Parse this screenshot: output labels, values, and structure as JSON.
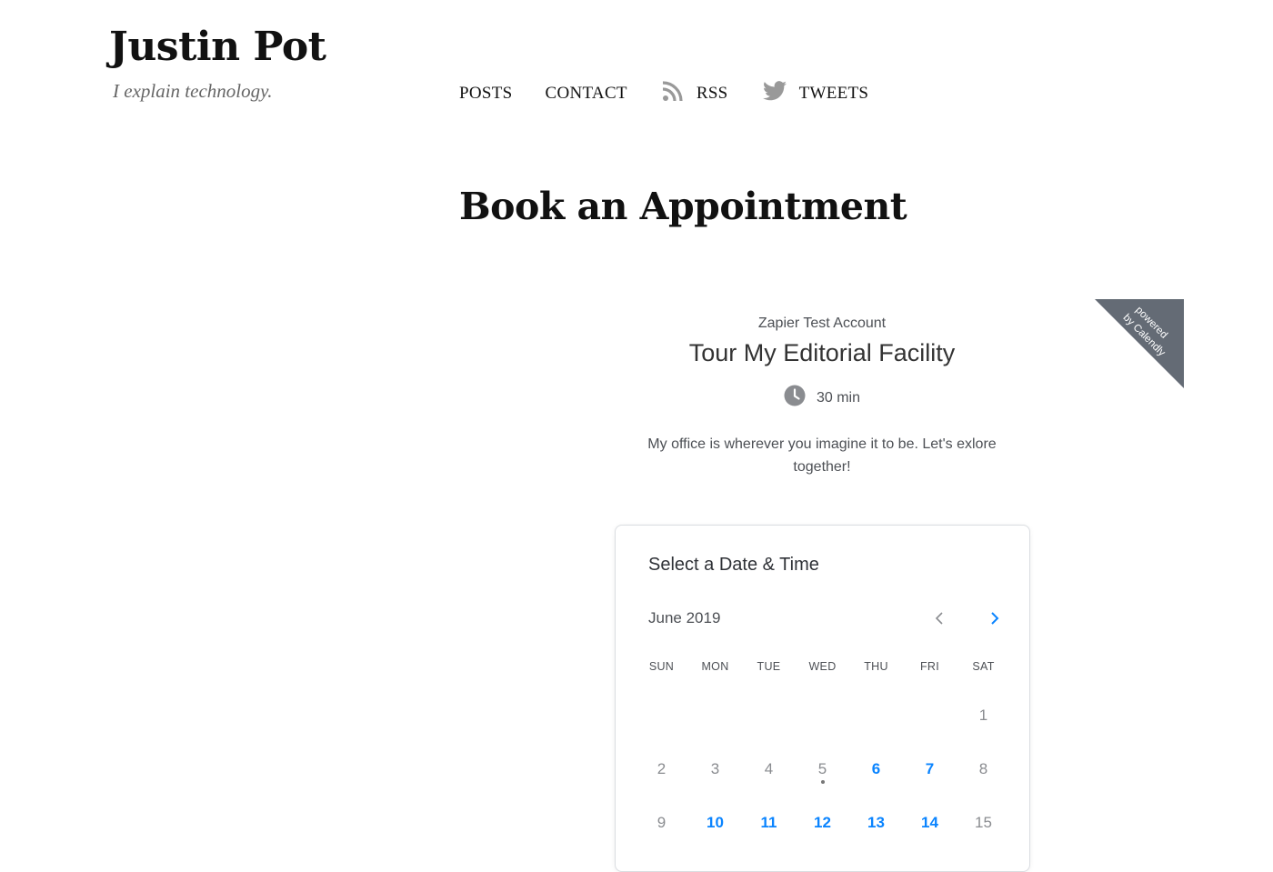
{
  "site": {
    "title": "Justin Pot",
    "tagline": "I explain technology."
  },
  "nav": {
    "items": [
      {
        "label": "POSTS",
        "icon": null
      },
      {
        "label": "CONTACT",
        "icon": null
      },
      {
        "label": "RSS",
        "icon": "rss-icon"
      },
      {
        "label": "TWEETS",
        "icon": "twitter-bird-icon"
      }
    ],
    "icon_color": "#999999"
  },
  "page": {
    "title": "Book an Appointment"
  },
  "calendly": {
    "badge_line1": "powered",
    "badge_line2": "by Calendly",
    "badge_color": "#646b75",
    "account": "Zapier Test Account",
    "event_title": "Tour My Editorial Facility",
    "duration": "30 min",
    "description": "My office is wherever you imagine it to be. Let's exlore together!",
    "picker": {
      "title": "Select a Date & Time",
      "month": "June 2019",
      "accent_color": "#0a84ff",
      "weekdays": [
        "SUN",
        "MON",
        "TUE",
        "WED",
        "THU",
        "FRI",
        "SAT"
      ],
      "weeks": [
        [
          null,
          null,
          null,
          null,
          null,
          null,
          {
            "day": "1",
            "available": false
          }
        ],
        [
          {
            "day": "2",
            "available": false
          },
          {
            "day": "3",
            "available": false
          },
          {
            "day": "4",
            "available": false
          },
          {
            "day": "5",
            "available": false,
            "today": true
          },
          {
            "day": "6",
            "available": true
          },
          {
            "day": "7",
            "available": true
          },
          {
            "day": "8",
            "available": false
          }
        ],
        [
          {
            "day": "9",
            "available": false
          },
          {
            "day": "10",
            "available": true
          },
          {
            "day": "11",
            "available": true
          },
          {
            "day": "12",
            "available": true
          },
          {
            "day": "13",
            "available": true
          },
          {
            "day": "14",
            "available": true
          },
          {
            "day": "15",
            "available": false
          }
        ]
      ]
    }
  }
}
